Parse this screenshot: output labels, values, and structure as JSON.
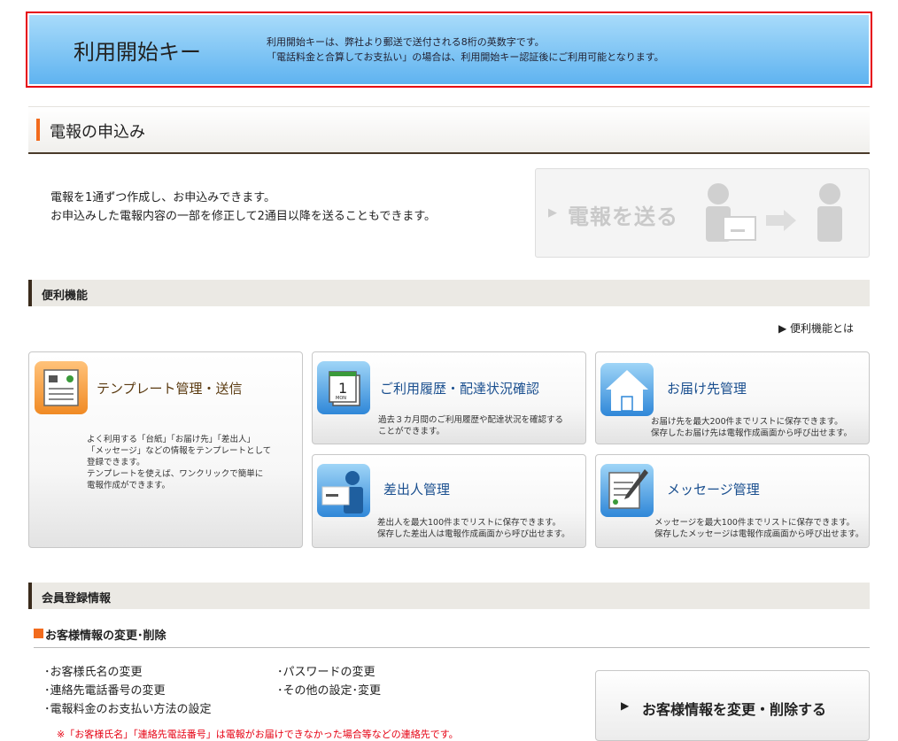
{
  "key_banner": {
    "title": "利用開始キー",
    "desc_line1": "利用開始キーは、弊社より郵送で送付される8桁の英数字です。",
    "desc_line2": "「電話料金と合算してお支払い」の場合は、利用開始キー認証後にご利用可能となります。",
    "border_color": "#e60012"
  },
  "telegram": {
    "heading": "電報の申込み",
    "desc_line1": "電報を1通ずつ作成し、お申込みできます。",
    "desc_line2": "お申込みした電報内容の一部を修正して2通目以降を送ることもできます。",
    "send_button": "電報を送る",
    "send_arrow": "▶"
  },
  "convenience": {
    "heading": "便利機能",
    "about_link": "▶ 便利機能とは",
    "cards": {
      "template": {
        "title": "テンプレート管理・送信",
        "lines": [
          "よく利用する「台紙」「お届け先」「差出人」",
          "「メッセージ」などの情報をテンプレートとして",
          "登録できます。",
          "テンプレートを使えば、ワンクリックで簡単に",
          "電報作成ができます。"
        ]
      },
      "history": {
        "title": "ご利用履歴・配達状況確認",
        "lines": [
          "過去３カ月間のご利用履歴や配達状況を確認する",
          "ことができます。"
        ],
        "icon_number": "1",
        "icon_day": "MON"
      },
      "destination": {
        "title": "お届け先管理",
        "lines": [
          "お届け先を最大200件までリストに保存できます。",
          "保存したお届け先は電報作成画面から呼び出せます。"
        ]
      },
      "sender": {
        "title": "差出人管理",
        "lines": [
          "差出人を最大100件までリストに保存できます。",
          "保存した差出人は電報作成画面から呼び出せます。"
        ]
      },
      "message": {
        "title": "メッセージ管理",
        "lines": [
          "メッセージを最大100件までリストに保存できます。",
          "保存したメッセージは電報作成画面から呼び出せます。"
        ]
      }
    }
  },
  "member": {
    "heading": "会員登録情報",
    "subheading": "お客様情報の変更･削除",
    "col1": [
      "･お客様氏名の変更",
      "･連絡先電話番号の変更",
      "･電報料金のお支払い方法の設定"
    ],
    "col2": [
      "･パスワードの変更",
      "･その他の設定･変更"
    ],
    "note": "※「お客様氏名」「連絡先電話番号」は電報がお届けできなかった場合等などの連絡先です。",
    "change_button": "お客様情報を変更・削除する",
    "change_arrow": "▶"
  },
  "colors": {
    "accent_orange": "#f26b1d",
    "link_blue": "#1a4f8f",
    "banner_blue": "#5fb3f0"
  }
}
